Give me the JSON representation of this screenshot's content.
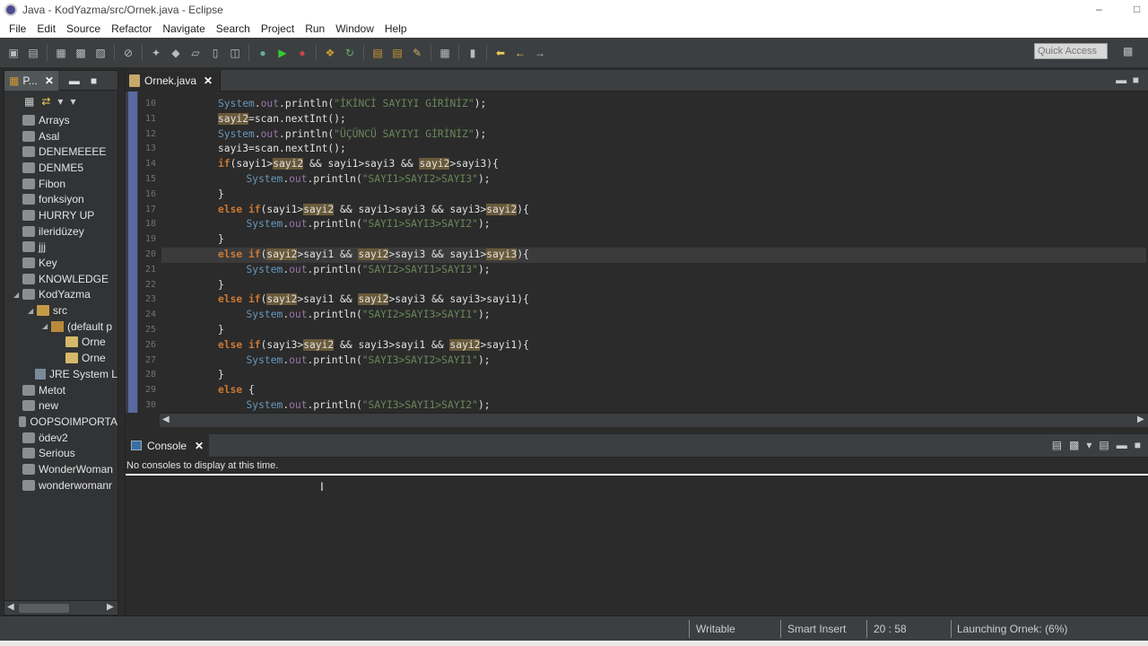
{
  "window": {
    "title": "Java - KodYazma/src/Ornek.java - Eclipse",
    "controls": [
      "–",
      "□"
    ]
  },
  "menu": [
    "File",
    "Edit",
    "Source",
    "Refactor",
    "Navigate",
    "Search",
    "Project",
    "Run",
    "Window",
    "Help"
  ],
  "toolbar": {
    "quick_access": "Quick Access"
  },
  "package_explorer": {
    "tab_label": "P...",
    "items": [
      {
        "label": "Arrays",
        "type": "project",
        "depth": 0
      },
      {
        "label": "Asal",
        "type": "project",
        "depth": 0
      },
      {
        "label": "DENEMEEEE",
        "type": "project",
        "depth": 0
      },
      {
        "label": "DENME5",
        "type": "project",
        "depth": 0
      },
      {
        "label": "Fibon",
        "type": "project",
        "depth": 0
      },
      {
        "label": "fonksiyon",
        "type": "project",
        "depth": 0
      },
      {
        "label": "HURRY UP",
        "type": "project",
        "depth": 0
      },
      {
        "label": "ileridüzey",
        "type": "project",
        "depth": 0
      },
      {
        "label": "jjj",
        "type": "project",
        "depth": 0
      },
      {
        "label": "Key",
        "type": "project",
        "depth": 0
      },
      {
        "label": "KNOWLEDGE",
        "type": "project",
        "depth": 0
      },
      {
        "label": "KodYazma",
        "type": "project",
        "depth": 0,
        "expanded": true
      },
      {
        "label": "src",
        "type": "folder",
        "depth": 1,
        "expanded": true
      },
      {
        "label": "(default p",
        "type": "package",
        "depth": 2,
        "expanded": true
      },
      {
        "label": "Orne",
        "type": "file",
        "depth": 3
      },
      {
        "label": "Orne",
        "type": "file",
        "depth": 3
      },
      {
        "label": "JRE System L",
        "type": "library",
        "depth": 1
      },
      {
        "label": "Metot",
        "type": "project",
        "depth": 0
      },
      {
        "label": "new",
        "type": "project",
        "depth": 0
      },
      {
        "label": "OOPSOIMPORTA",
        "type": "project",
        "depth": 0
      },
      {
        "label": "ödev2",
        "type": "project",
        "depth": 0
      },
      {
        "label": "Serious",
        "type": "project",
        "depth": 0
      },
      {
        "label": "WonderWoman",
        "type": "project",
        "depth": 0
      },
      {
        "label": "wonderwomanr",
        "type": "project",
        "depth": 0
      }
    ]
  },
  "editor": {
    "tab_label": "Ornek.java",
    "current_line": 20,
    "lines": [
      {
        "n": "10",
        "html": "<span class='cls'>System</span>.<span class='fld'>out</span>.println(<span class='str'>\"İKİNCİ SAYIYI GİRİNİZ\"</span>);",
        "indent": 0
      },
      {
        "n": "11",
        "html": "<span class='hl'>sayi2</span>=scan.nextInt();",
        "indent": 0
      },
      {
        "n": "12",
        "html": "<span class='cls'>System</span>.<span class='fld'>out</span>.println(<span class='str'>\"ÜÇÜNCÜ SAYIYI GİRİNİZ\"</span>);",
        "indent": 0
      },
      {
        "n": "13",
        "html": "sayi3=scan.nextInt();",
        "indent": 0
      },
      {
        "n": "14",
        "html": "<span class='kw'>if</span>(sayi1&gt;<span class='hl'>sayi2</span> &amp;&amp; sayi1&gt;sayi3 &amp;&amp; <span class='hl'>sayi2</span>&gt;sayi3){",
        "indent": 0
      },
      {
        "n": "15",
        "html": "<span class='cls'>System</span>.<span class='fld'>out</span>.println(<span class='str'>\"SAYI1&gt;SAYI2&gt;SAYI3\"</span>);",
        "indent": 1
      },
      {
        "n": "16",
        "html": "}",
        "indent": 0
      },
      {
        "n": "17",
        "html": "<span class='kw'>else if</span>(sayi1&gt;<span class='hl'>sayi2</span> &amp;&amp; sayi1&gt;sayi3 &amp;&amp; sayi3&gt;<span class='hl'>sayi2</span>){",
        "indent": 0
      },
      {
        "n": "18",
        "html": "<span class='cls'>System</span>.<span class='fld'>out</span>.println(<span class='str'>\"SAYI1&gt;SAYI3&gt;SAYI2\"</span>);",
        "indent": 1
      },
      {
        "n": "19",
        "html": "}",
        "indent": 0
      },
      {
        "n": "20",
        "html": "<span class='kw'>else if</span>(<span class='hl'>sayi2</span>&gt;sayi1 &amp;&amp; <span class='hl'>sayi2</span>&gt;sayi3 &amp;&amp; sayi1&gt;<span class='hl'>sayi3</span>){",
        "indent": 0
      },
      {
        "n": "21",
        "html": "<span class='cls'>System</span>.<span class='fld'>out</span>.println(<span class='str'>\"SAYI2&gt;SAYI1&gt;SAYI3\"</span>);",
        "indent": 1
      },
      {
        "n": "22",
        "html": "}",
        "indent": 0
      },
      {
        "n": "23",
        "html": "<span class='kw'>else if</span>(<span class='hl'>sayi2</span>&gt;sayi1 &amp;&amp; <span class='hl'>sayi2</span>&gt;sayi3 &amp;&amp; sayi3&gt;sayi1){",
        "indent": 0
      },
      {
        "n": "24",
        "html": "<span class='cls'>System</span>.<span class='fld'>out</span>.println(<span class='str'>\"SAYI2&gt;SAYI3&gt;SAYI1\"</span>);",
        "indent": 1
      },
      {
        "n": "25",
        "html": "}",
        "indent": 0
      },
      {
        "n": "26",
        "html": "<span class='kw'>else if</span>(sayi3&gt;<span class='hl'>sayi2</span> &amp;&amp; sayi3&gt;sayi1 &amp;&amp; <span class='hl'>sayi2</span>&gt;sayi1){",
        "indent": 0
      },
      {
        "n": "27",
        "html": "<span class='cls'>System</span>.<span class='fld'>out</span>.println(<span class='str'>\"SAYI3&gt;SAYI2&gt;SAYI1\"</span>);",
        "indent": 1
      },
      {
        "n": "28",
        "html": "}",
        "indent": 0
      },
      {
        "n": "29",
        "html": "<span class='kw'>else</span> {",
        "indent": 0
      },
      {
        "n": "30",
        "html": "<span class='cls'>System</span>.<span class='fld'>out</span>.println(<span class='str'>\"SAYI3&gt;SAYI1&gt;SAYI2\"</span>);",
        "indent": 1
      }
    ]
  },
  "console": {
    "tab_label": "Console",
    "message": "No consoles to display at this time."
  },
  "status": {
    "writable": "Writable",
    "insert_mode": "Smart Insert",
    "position": "20 : 58",
    "task": "Launching Ornek: (6%)"
  },
  "colors": {
    "editor_bg": "#2b2b2b",
    "keyword": "#cc7832",
    "string": "#6a8759",
    "class": "#6897bb",
    "highlight": "#6a5a3a"
  }
}
